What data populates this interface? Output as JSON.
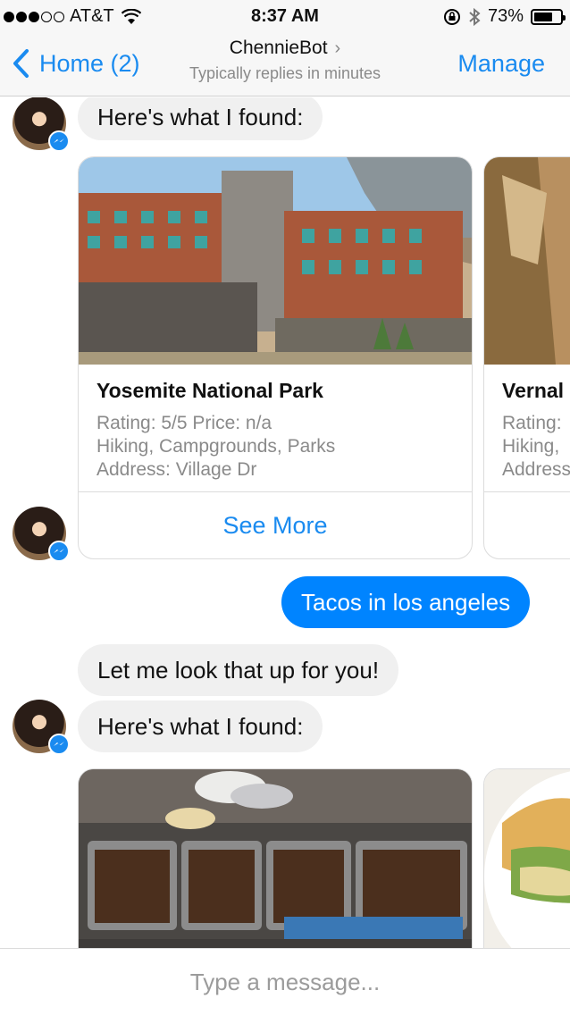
{
  "status": {
    "carrier": "AT&T",
    "time": "8:37 AM",
    "battery": "73%",
    "battery_level": 0.73
  },
  "nav": {
    "back_label": "Home (2)",
    "title": "ChennieBot",
    "subtitle": "Typically replies in minutes",
    "manage_label": "Manage"
  },
  "messages": {
    "found_1": "Here's what I found:",
    "user_query": "Tacos in los angeles",
    "lookup": "Let me look that up for you!",
    "found_2": "Here's what I found:"
  },
  "cards_1": [
    {
      "title": "Yosemite National Park",
      "line1": "Rating: 5/5 Price: n/a",
      "line2": "Hiking, Campgrounds, Parks",
      "line3": "Address: Village Dr",
      "button": "See More"
    },
    {
      "title": "Vernal",
      "line1": "Rating:",
      "line2": "Hiking,",
      "line3": "Address"
    }
  ],
  "composer": {
    "placeholder": "Type a message..."
  },
  "colors": {
    "accent": "#0084ff",
    "link": "#1a8bf0"
  }
}
